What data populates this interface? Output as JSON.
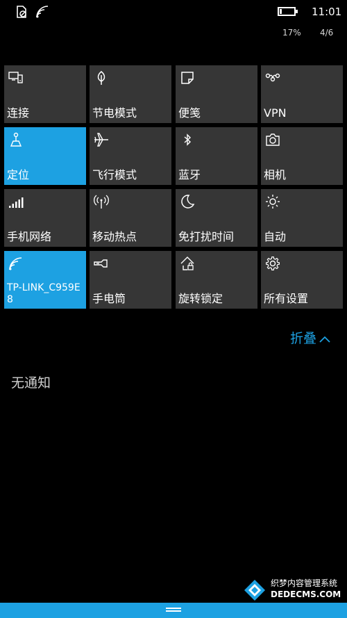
{
  "status_bar": {
    "time": "11:01",
    "battery_percent": "17%",
    "page_indicator": "4/6",
    "battery_level": 0.17,
    "icons": [
      "no-sim-icon",
      "wifi-icon",
      "battery-icon"
    ]
  },
  "quick_actions": [
    {
      "label": "连接",
      "icon": "project-connect-icon",
      "active": false
    },
    {
      "label": "节电模式",
      "icon": "leaf-icon",
      "active": false
    },
    {
      "label": "便笺",
      "icon": "note-icon",
      "active": false
    },
    {
      "label": "VPN",
      "icon": "vpn-icon",
      "active": false
    },
    {
      "label": "定位",
      "icon": "location-icon",
      "active": true
    },
    {
      "label": "飞行模式",
      "icon": "airplane-icon",
      "active": false
    },
    {
      "label": "蓝牙",
      "icon": "bluetooth-icon",
      "active": false
    },
    {
      "label": "相机",
      "icon": "camera-icon",
      "active": false
    },
    {
      "label": "手机网络",
      "icon": "cellular-icon",
      "active": false
    },
    {
      "label": "移动热点",
      "icon": "hotspot-icon",
      "active": false
    },
    {
      "label": "免打扰时间",
      "icon": "moon-icon",
      "active": false
    },
    {
      "label": "自动",
      "icon": "brightness-icon",
      "active": false
    },
    {
      "label": "TP-LINK_C959E8",
      "icon": "wifi-icon",
      "active": true
    },
    {
      "label": "手电筒",
      "icon": "flashlight-icon",
      "active": false
    },
    {
      "label": "旋转锁定",
      "icon": "rotation-lock-icon",
      "active": false
    },
    {
      "label": "所有设置",
      "icon": "gear-icon",
      "active": false
    }
  ],
  "collapse_label": "折叠",
  "no_notifications": "无通知",
  "watermark": {
    "text": "织梦内容管理系统",
    "url": "DEDECMS.COM"
  },
  "colors": {
    "accent": "#1da1e2",
    "tile": "#363636",
    "background": "#000000"
  }
}
